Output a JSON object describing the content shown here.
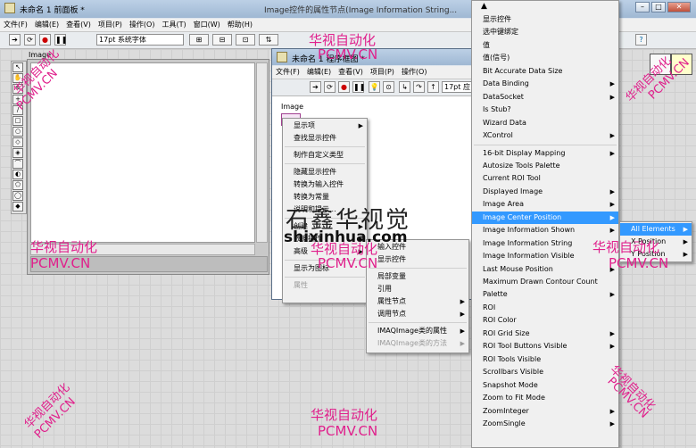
{
  "main_window": {
    "title": "未命名 1 前面板 *",
    "menu": [
      "文件(F)",
      "编辑(E)",
      "查看(V)",
      "项目(P)",
      "操作(O)",
      "工具(T)",
      "窗口(W)",
      "帮助(H)"
    ],
    "font_select": "17pt 系统字体",
    "image_label": "Image",
    "partial_title": "Image控件的属性节点(Image Information String..."
  },
  "block_diagram": {
    "title": "未命名 1 程序框图 *",
    "menu": [
      "文件(F)",
      "编辑(E)",
      "查看(V)",
      "项目(P)",
      "操作(O)"
    ],
    "font_select": "17pt 应",
    "image_label": "Image"
  },
  "context_menu_1": {
    "items": [
      {
        "label": "显示项",
        "sub": true,
        "enabled": true
      },
      {
        "label": "查找显示控件",
        "sub": false,
        "enabled": true
      },
      {
        "label": "制作自定义类型",
        "sub": false,
        "enabled": true
      },
      {
        "label": "隐藏显示控件",
        "sub": false,
        "enabled": true
      },
      {
        "label": "转换为输入控件",
        "sub": false,
        "enabled": true
      },
      {
        "label": "转换为常量",
        "sub": false,
        "enabled": true
      },
      {
        "label": "说明和提示...",
        "sub": false,
        "enabled": true
      },
      {
        "label": "创建",
        "sub": true,
        "enabled": true
      },
      {
        "label": "数据操作",
        "sub": true,
        "enabled": true
      },
      {
        "label": "高级",
        "sub": true,
        "enabled": true
      },
      {
        "label": "显示为图标",
        "sub": false,
        "enabled": true
      },
      {
        "label": "属性",
        "sub": false,
        "enabled": false
      }
    ]
  },
  "context_menu_2": {
    "items": [
      {
        "label": "输入控件",
        "sub": false,
        "enabled": true
      },
      {
        "label": "显示控件",
        "sub": false,
        "enabled": true
      },
      {
        "label": "局部变量",
        "sub": false,
        "enabled": true
      },
      {
        "label": "引用",
        "sub": false,
        "enabled": true
      },
      {
        "label": "属性节点",
        "sub": true,
        "enabled": true
      },
      {
        "label": "调用节点",
        "sub": true,
        "enabled": true
      },
      {
        "label": "IMAQImage类的属性",
        "sub": true,
        "enabled": true
      },
      {
        "label": "IMAQImage类的方法",
        "sub": true,
        "enabled": false
      }
    ]
  },
  "property_menu": {
    "items": [
      {
        "label": "显示控件",
        "sub": false
      },
      {
        "label": "选中键绑定",
        "sub": false
      },
      {
        "label": "值",
        "sub": false
      },
      {
        "label": "值(信号)",
        "sub": false
      },
      {
        "label": "Bit Accurate Data Size",
        "sub": false
      },
      {
        "label": "Data Binding",
        "sub": true
      },
      {
        "label": "DataSocket",
        "sub": true
      },
      {
        "label": "Is Stub?",
        "sub": false
      },
      {
        "label": "Wizard Data",
        "sub": false
      },
      {
        "label": "XControl",
        "sub": true
      },
      {
        "label": "16-bit Display Mapping",
        "sub": true
      },
      {
        "label": "Autosize Tools Palette",
        "sub": false
      },
      {
        "label": "Current ROI Tool",
        "sub": false
      },
      {
        "label": "Displayed Image",
        "sub": true
      },
      {
        "label": "Image Area",
        "sub": true
      },
      {
        "label": "Image Center Position",
        "sub": true
      },
      {
        "label": "Image Information Shown",
        "sub": true
      },
      {
        "label": "Image Information String",
        "sub": false
      },
      {
        "label": "Image Information Visible",
        "sub": false
      },
      {
        "label": "Last Mouse Position",
        "sub": true
      },
      {
        "label": "Maximum Drawn Contour Count",
        "sub": false
      },
      {
        "label": "Palette",
        "sub": true
      },
      {
        "label": "ROI",
        "sub": false
      },
      {
        "label": "ROI Color",
        "sub": false
      },
      {
        "label": "ROI Grid Size",
        "sub": true
      },
      {
        "label": "ROI Tool Buttons Visible",
        "sub": true
      },
      {
        "label": "ROI Tools Visible",
        "sub": false
      },
      {
        "label": "Scrollbars Visible",
        "sub": false
      },
      {
        "label": "Snapshot Mode",
        "sub": false
      },
      {
        "label": "Zoom to Fit Mode",
        "sub": false
      },
      {
        "label": "ZoomInteger",
        "sub": true
      },
      {
        "label": "ZoomSingle",
        "sub": true
      }
    ],
    "highlighted": "Image Center Position"
  },
  "submenu_center": {
    "items": [
      "All Elements",
      "X Position",
      "Y Position"
    ],
    "highlighted": "All Elements"
  },
  "watermarks": {
    "cn": "华视自动化",
    "en": "PCMV.CN",
    "logo": "石鑫华视觉",
    "url": "shixinhua.com"
  },
  "colors": {
    "highlight": "#3399ff",
    "watermark": "#e0208c",
    "title_bar": "#bcd0e6"
  }
}
